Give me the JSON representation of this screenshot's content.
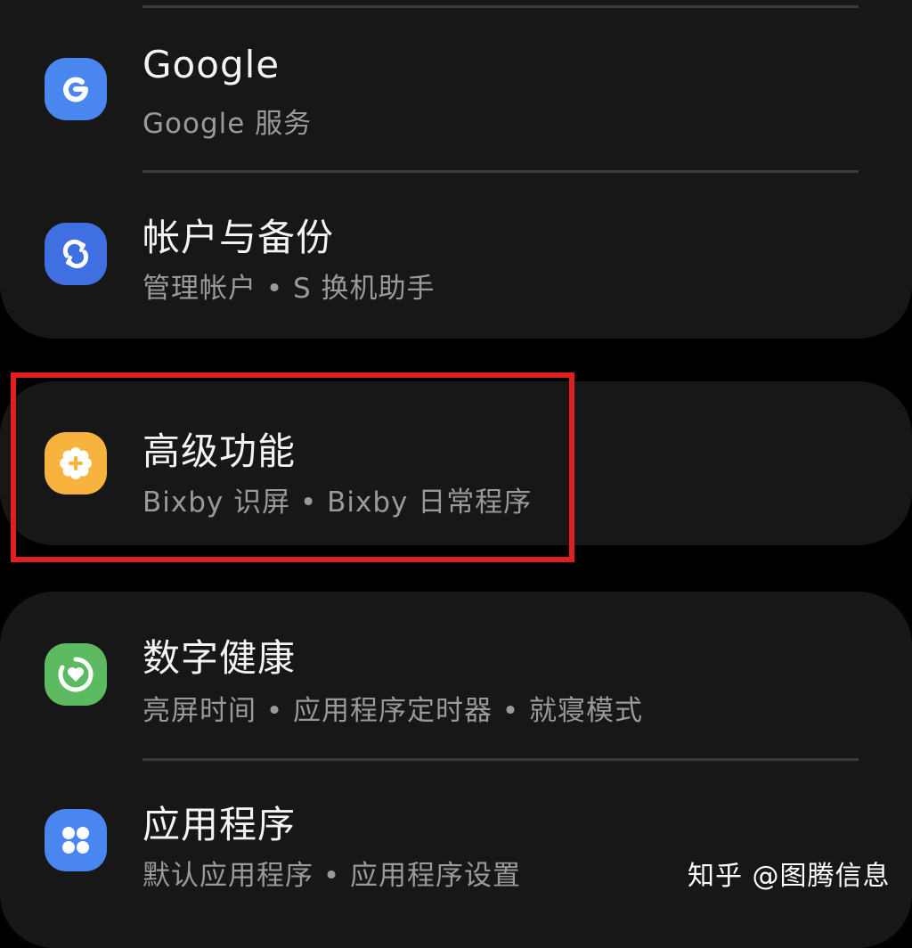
{
  "settings": {
    "items": [
      {
        "title": "Google",
        "subtitle": "Google 服务",
        "icon": "google-icon",
        "icon_color": "#4a86f0"
      },
      {
        "title": "帐户与备份",
        "subtitle": "管理帐户 • S 换机助手",
        "icon": "sync-icon",
        "icon_color": "#3f6fe0"
      },
      {
        "title": "高级功能",
        "subtitle": "Bixby 识屏 • Bixby 日常程序",
        "icon": "gear-plus-icon",
        "icon_color": "#f8b23e"
      },
      {
        "title": "数字健康",
        "subtitle": "亮屏时间 • 应用程序定时器 • 就寝模式",
        "icon": "wellbeing-heart-icon",
        "icon_color": "#5cba61"
      },
      {
        "title": "应用程序",
        "subtitle": "默认应用程序 • 应用程序设置",
        "icon": "apps-grid-icon",
        "icon_color": "#4a86f0"
      }
    ]
  },
  "highlight_color": "#e02020",
  "watermark": "知乎 @图腾信息"
}
